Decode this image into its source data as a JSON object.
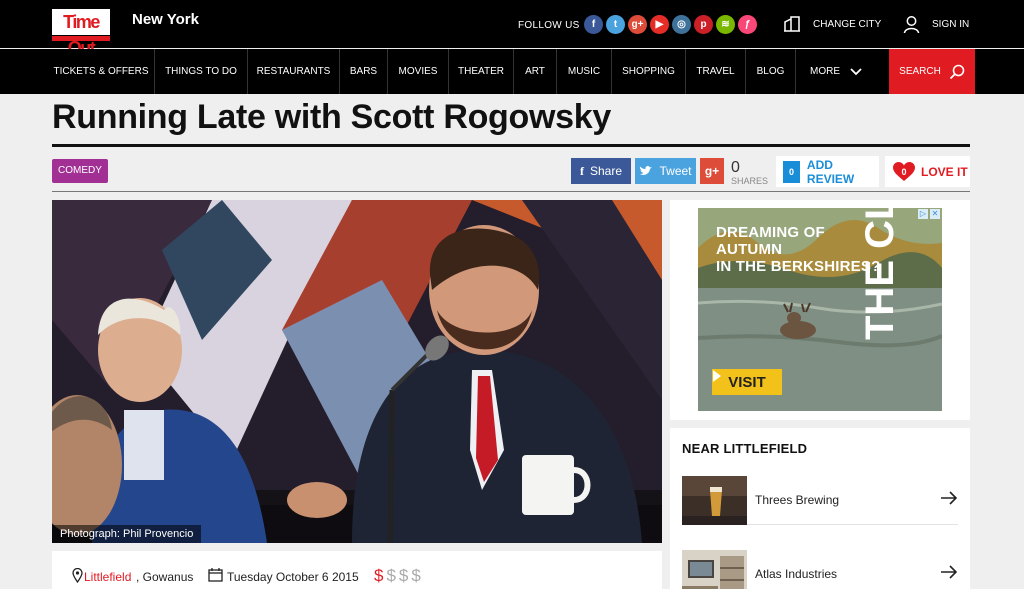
{
  "header": {
    "logo_text": "Time Out",
    "city": "New York",
    "follow_label": "FOLLOW US",
    "socials": [
      {
        "icon": "facebook-icon",
        "glyph": "f",
        "color": "#3b5998"
      },
      {
        "icon": "twitter-icon",
        "glyph": "t",
        "color": "#4aa3df"
      },
      {
        "icon": "google-plus-icon",
        "glyph": "g+",
        "color": "#dd4b39"
      },
      {
        "icon": "youtube-icon",
        "glyph": "▶",
        "color": "#e52d27"
      },
      {
        "icon": "instagram-icon",
        "glyph": "◎",
        "color": "#3f729b"
      },
      {
        "icon": "pinterest-icon",
        "glyph": "p",
        "color": "#cb2027"
      },
      {
        "icon": "spotify-icon",
        "glyph": "≋",
        "color": "#7ab800"
      },
      {
        "icon": "foursquare-icon",
        "glyph": "ƒ",
        "color": "#f94877"
      }
    ],
    "change_city": "CHANGE CITY",
    "sign_in": "SIGN IN"
  },
  "nav": {
    "items": [
      "TICKETS & OFFERS",
      "THINGS TO DO",
      "RESTAURANTS",
      "BARS",
      "MOVIES",
      "THEATER",
      "ART",
      "MUSIC",
      "SHOPPING",
      "TRAVEL",
      "BLOG",
      "MORE"
    ],
    "search": "SEARCH"
  },
  "article": {
    "title": "Running Late with Scott Rogowsky",
    "category": "COMEDY",
    "share_label": "Share",
    "tweet_label": "Tweet",
    "gplus_label": "g+",
    "share_count": "0",
    "shares_label": "SHARES",
    "review_count": "0",
    "add_review": "ADD REVIEW",
    "love_count": "0",
    "love_it": "LOVE IT",
    "photo_credit": "Photograph: Phil Provencio",
    "venue": "Littlefield",
    "area": ", Gowanus",
    "date": "Tuesday October 6 2015",
    "price_symbols": "$",
    "price_off": "$$$",
    "price_level": 1,
    "price_max": 4
  },
  "ad": {
    "headline_line1": "DREAMING OF AUTUMN",
    "headline_line2": "IN THE BERKSHIRES?",
    "cta": "VISIT",
    "brand": "THE CLARK"
  },
  "near": {
    "title": "NEAR LITTLEFIELD",
    "items": [
      {
        "name": "Threes Brewing"
      },
      {
        "name": "Atlas Industries"
      }
    ]
  }
}
